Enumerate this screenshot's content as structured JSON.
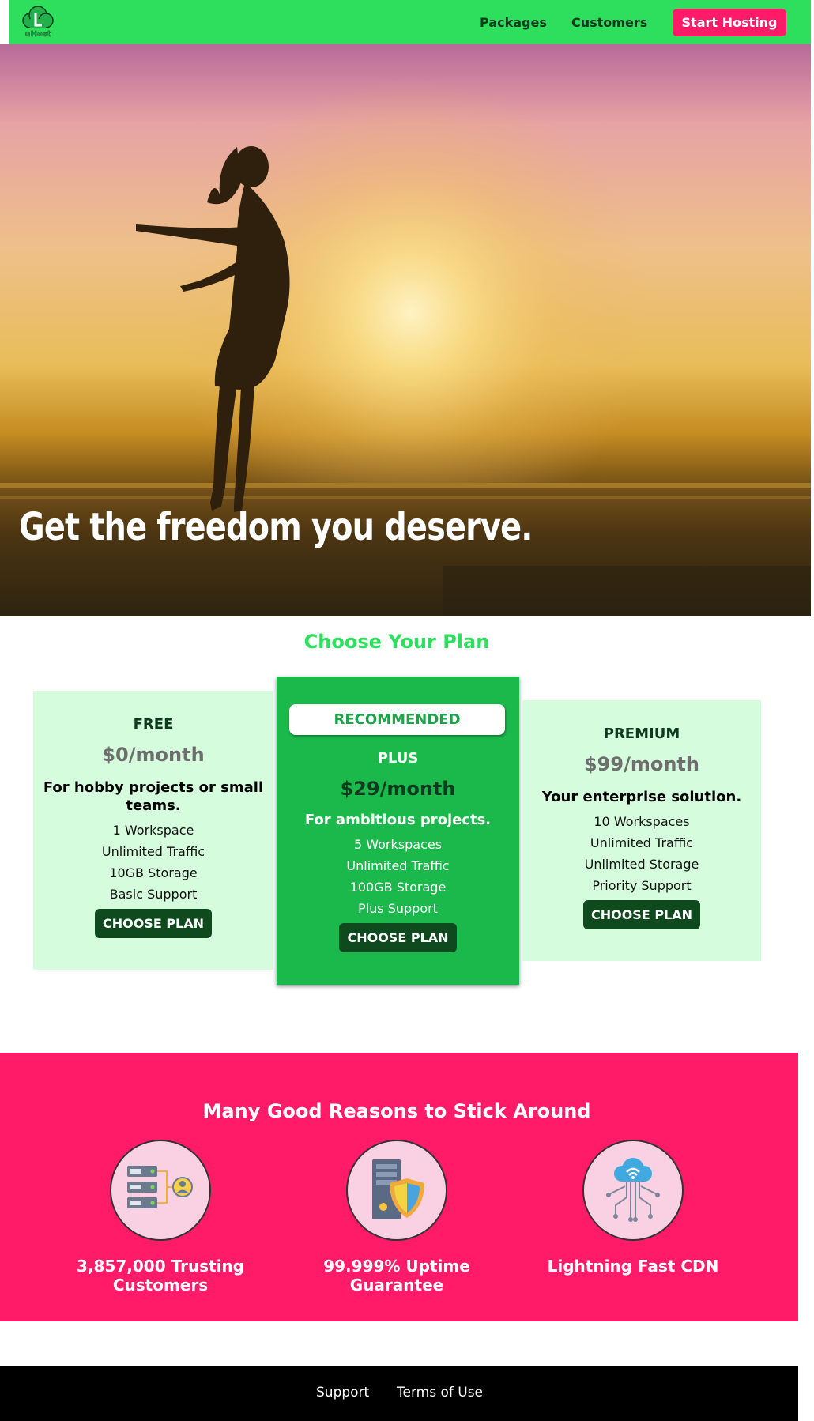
{
  "header": {
    "logo_text": "uHost",
    "nav": [
      "Packages",
      "Customers"
    ],
    "cta": "Start Hosting"
  },
  "hero": {
    "title": "Get the freedom you deserve."
  },
  "plans": {
    "title": "Choose Your Plan",
    "items": [
      {
        "name": "FREE",
        "price": "$0/month",
        "description": "For hobby projects or small teams.",
        "features": [
          "1 Workspace",
          "Unlimited Traffic",
          "10GB Storage",
          "Basic Support"
        ],
        "button": "CHOOSE PLAN"
      },
      {
        "badge": "RECOMMENDED",
        "name": "PLUS",
        "price": "$29/month",
        "description": "For ambitious projects.",
        "features": [
          "5 Workspaces",
          "Unlimited Traffic",
          "100GB Storage",
          "Plus Support"
        ],
        "button": "CHOOSE PLAN"
      },
      {
        "name": "PREMIUM",
        "price": "$99/month",
        "description": "Your enterprise solution.",
        "features": [
          "10 Workspaces",
          "Unlimited Traffic",
          "Unlimited Storage",
          "Priority Support"
        ],
        "button": "CHOOSE PLAN"
      }
    ]
  },
  "reasons": {
    "title": "Many Good Reasons to Stick Around",
    "items": [
      {
        "label": "3,857,000 Trusting Customers",
        "icon": "customers-server-icon"
      },
      {
        "label": "99.999% Uptime Guarantee",
        "icon": "server-shield-icon"
      },
      {
        "label": "Lightning Fast CDN",
        "icon": "cloud-network-icon"
      }
    ]
  },
  "footer": {
    "links": [
      "Support",
      "Terms of Use"
    ]
  },
  "colors": {
    "brand_green": "#2ddf5c",
    "accent_pink": "#ff1b68",
    "plan_bg": "#d5fcdc",
    "plan_highlight": "#1bb84b",
    "button_dark": "#0e4a1e",
    "footer_bg": "#000000"
  }
}
